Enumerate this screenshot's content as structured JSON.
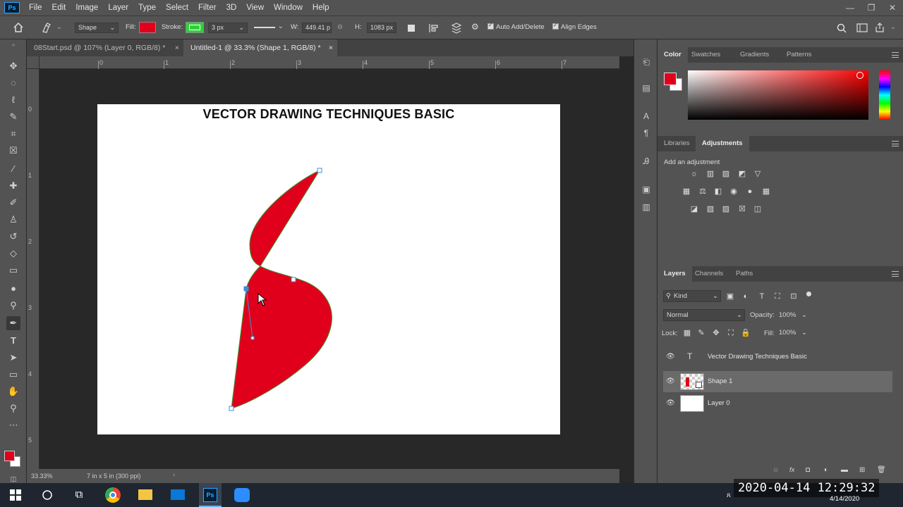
{
  "menubar": {
    "logo": "Ps",
    "items": [
      "File",
      "Edit",
      "Image",
      "Layer",
      "Type",
      "Select",
      "Filter",
      "3D",
      "View",
      "Window",
      "Help"
    ],
    "window_controls": [
      "—",
      "❐",
      "✕"
    ]
  },
  "options": {
    "tool_mode": "Shape",
    "fill_label": "Fill:",
    "fill_color": "#e0001b",
    "stroke_label": "Stroke:",
    "stroke_color": "#2fd13a",
    "stroke_width": "3 px",
    "w_label": "W:",
    "w_value": "449.41 p",
    "h_label": "H:",
    "h_value": "1083 px",
    "auto_add_delete": "Auto Add/Delete",
    "align_edges": "Align Edges"
  },
  "doc_tabs": [
    {
      "label": "08Start.psd @ 107% (Layer 0, RGB/8) *",
      "close": "×"
    },
    {
      "label": "Untitled-1 @ 33.3% (Shape 1, RGB/8) *",
      "close": "×"
    }
  ],
  "rulers": {
    "h_numbers": [
      "0",
      "1",
      "2",
      "3",
      "4",
      "5",
      "6",
      "7"
    ],
    "v_numbers": [
      "0",
      "1",
      "2",
      "3",
      "4",
      "5"
    ]
  },
  "canvas": {
    "title": "VECTOR DRAWING TECHNIQUES BASIC",
    "shape_fill": "#e0001b",
    "shape_stroke": "#3a9a3a"
  },
  "status": {
    "zoom": "33.33%",
    "doc_info": "7 in x 5 in (300 ppi)"
  },
  "color_panel": {
    "tabs": [
      "Color",
      "Swatches",
      "Gradients",
      "Patterns"
    ],
    "foreground": "#e0001b",
    "background": "#ffffff"
  },
  "adjustments_panel": {
    "tabs": [
      "Libraries",
      "Adjustments"
    ],
    "heading": "Add an adjustment"
  },
  "layers_panel": {
    "tabs": [
      "Layers",
      "Channels",
      "Paths"
    ],
    "filter_kind": "Kind",
    "blend_mode": "Normal",
    "opacity_label": "Opacity:",
    "opacity_value": "100%",
    "lock_label": "Lock:",
    "fill_label": "Fill:",
    "fill_value": "100%",
    "layers": [
      {
        "name": "Vector Drawing Techniques Basic",
        "type": "text"
      },
      {
        "name": "Shape 1",
        "type": "shape",
        "selected": true
      },
      {
        "name": "Layer 0",
        "type": "pixel"
      }
    ],
    "bottom_icons": [
      "fx"
    ]
  },
  "taskbar": {
    "clock_overlay": "2020-04-14  12:29:32",
    "date": "4/14/2020"
  }
}
